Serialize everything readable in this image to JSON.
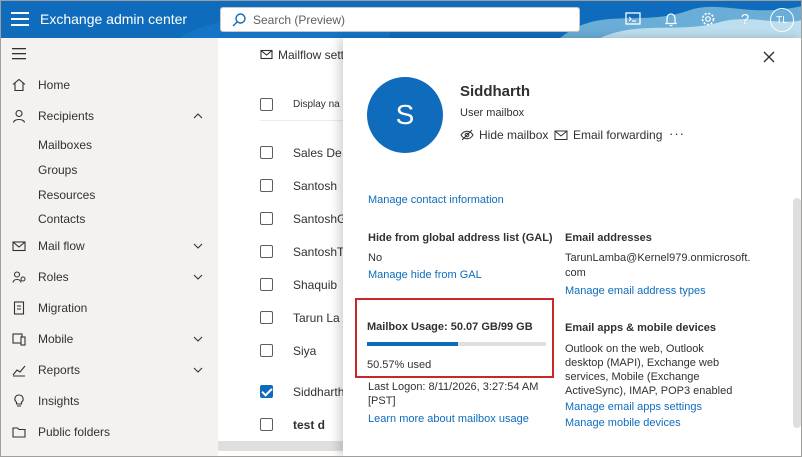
{
  "header": {
    "app_title": "Exchange admin center",
    "search_placeholder": "Search (Preview)",
    "user_initials": "TL",
    "icons": [
      "cloud-shell-icon",
      "bell-icon",
      "gear-icon",
      "help-icon"
    ]
  },
  "sidebar": {
    "items": [
      {
        "label": "Home",
        "icon": "home-icon"
      },
      {
        "label": "Recipients",
        "icon": "person-icon",
        "expanded": true
      },
      {
        "label": "Mail flow",
        "icon": "mail-icon"
      },
      {
        "label": "Roles",
        "icon": "roles-icon"
      },
      {
        "label": "Migration",
        "icon": "migration-icon"
      },
      {
        "label": "Mobile",
        "icon": "mobile-icon"
      },
      {
        "label": "Reports",
        "icon": "reports-icon"
      },
      {
        "label": "Insights",
        "icon": "insights-icon"
      },
      {
        "label": "Public folders",
        "icon": "folder-icon"
      }
    ],
    "recipients_sub": [
      "Mailboxes",
      "Groups",
      "Resources",
      "Contacts"
    ]
  },
  "list": {
    "toolbar_label": "Mailflow setti",
    "column_header": "Display na",
    "rows": [
      "Sales De",
      "Santosh",
      "SantoshG",
      "SantoshT",
      "Shaquib",
      "Tarun La",
      "Siya",
      "Siddharth",
      "test d"
    ],
    "checked_row": "Siddharth"
  },
  "panel": {
    "initial": "S",
    "name": "Siddharth",
    "type": "User mailbox",
    "actions": {
      "hide": "Hide mailbox",
      "forward": "Email forwarding",
      "more": "···"
    },
    "manage_contact": "Manage contact information",
    "gal_title": "Hide from global address list (GAL)",
    "gal_value": "No",
    "gal_link": "Manage hide from GAL",
    "email_title": "Email addresses",
    "email_line1": "TarunLamba@Kernel979.onmicrosoft.",
    "email_line2": "com",
    "email_link": "Manage email address types",
    "usage_title": "Mailbox Usage: 50.07 GB/99 GB",
    "usage_percent": 50.57,
    "usage_text": "50.57% used",
    "logon_line1": "Last Logon: 8/11/2026, 3:27:54 AM",
    "logon_line2": "[PST]",
    "usage_link": "Learn more about mailbox usage",
    "apps_title": "Email apps & mobile devices",
    "apps_lines": [
      "Outlook on the web, Outlook",
      "desktop (MAPI), Exchange web",
      "services, Mobile (Exchange",
      "ActiveSync), IMAP, POP3 enabled"
    ],
    "apps_link": "Manage email apps settings",
    "devices_link": "Manage mobile devices"
  },
  "colors": {
    "accent": "#0f6cbd",
    "highlight_border": "#c8282a",
    "sidebar_bg": "#f3f2f1"
  }
}
